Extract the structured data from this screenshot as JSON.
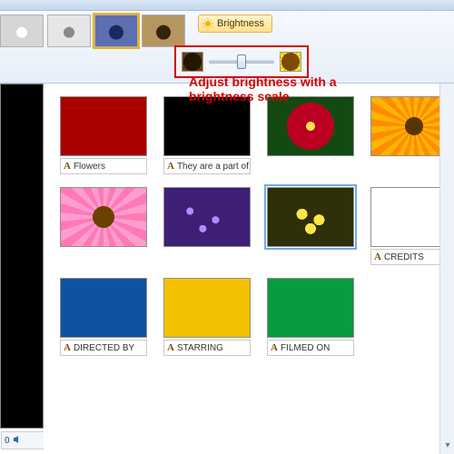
{
  "ribbon": {
    "brightness_label": "Brightness"
  },
  "annotation": {
    "text": "Adjust brightness with a brightness scale"
  },
  "preview": {
    "zoom": "0"
  },
  "storyboard": {
    "rows": [
      {
        "clips": [
          {
            "caption": "Flowers"
          },
          {
            "caption": "They are a part of..."
          },
          {
            "caption": ""
          },
          {
            "caption": ""
          }
        ]
      },
      {
        "clips": [
          {
            "caption": ""
          },
          {
            "caption": ""
          },
          {
            "caption": ""
          },
          {
            "caption": "CREDITS"
          }
        ]
      },
      {
        "clips": [
          {
            "caption": "DIRECTED BY"
          },
          {
            "caption": "STARRING"
          },
          {
            "caption": "FILMED ON"
          }
        ]
      }
    ]
  }
}
